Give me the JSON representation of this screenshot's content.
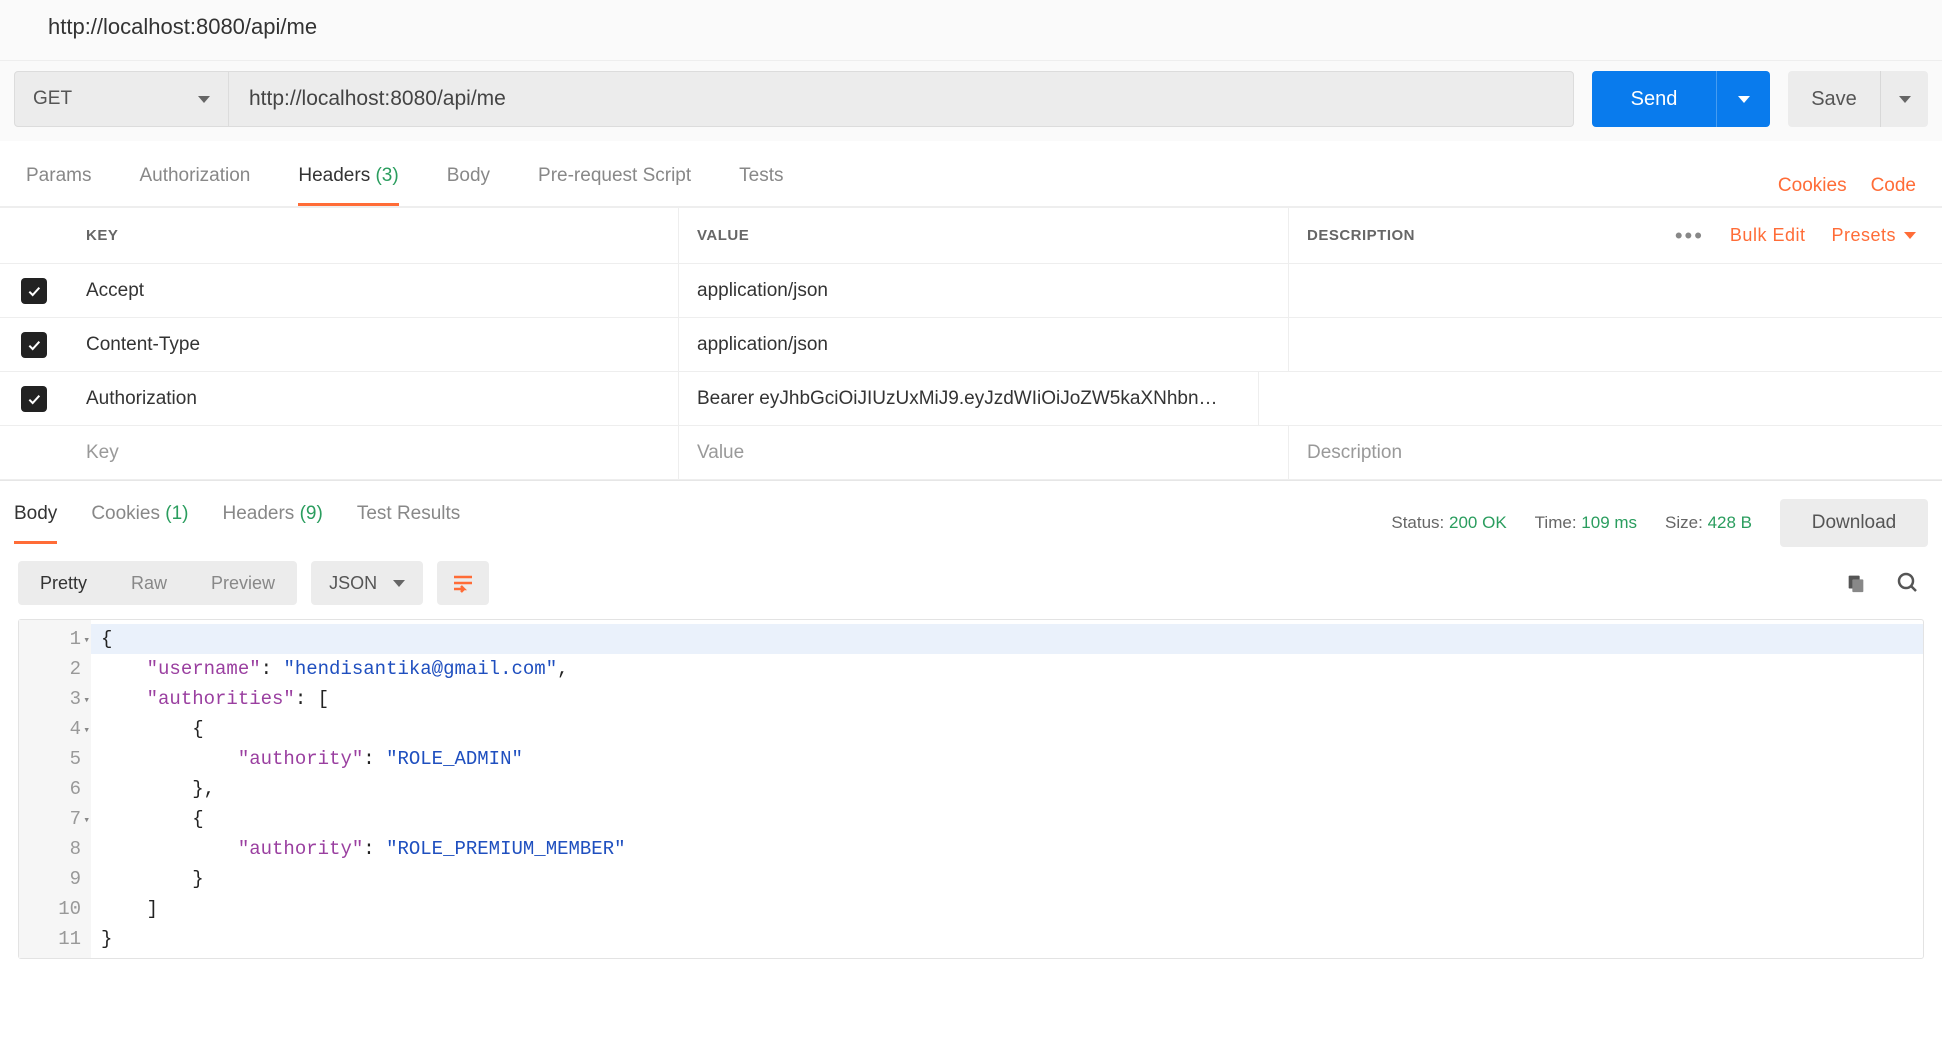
{
  "title": "http://localhost:8080/api/me",
  "request": {
    "method": "GET",
    "url": "http://localhost:8080/api/me",
    "send_label": "Send",
    "save_label": "Save"
  },
  "tabs": {
    "params": "Params",
    "authorization": "Authorization",
    "headers_label": "Headers",
    "headers_count": "(3)",
    "body": "Body",
    "prerequest": "Pre-request Script",
    "tests": "Tests",
    "cookies_link": "Cookies",
    "code_link": "Code"
  },
  "headers_table": {
    "col_key": "KEY",
    "col_value": "VALUE",
    "col_desc": "DESCRIPTION",
    "bulk_edit": "Bulk Edit",
    "presets": "Presets",
    "placeholder_key": "Key",
    "placeholder_value": "Value",
    "placeholder_desc": "Description",
    "rows": [
      {
        "key": "Accept",
        "value": "application/json",
        "desc": ""
      },
      {
        "key": "Content-Type",
        "value": "application/json",
        "desc": ""
      },
      {
        "key": "Authorization",
        "value": "Bearer eyJhbGciOiJIUzUxMiJ9.eyJzdWIiOiJoZW5kaXNhbn…",
        "desc": ""
      }
    ]
  },
  "response": {
    "tabs": {
      "body": "Body",
      "cookies_label": "Cookies",
      "cookies_count": "(1)",
      "headers_label": "Headers",
      "headers_count": "(9)",
      "test_results": "Test Results"
    },
    "status_label": "Status:",
    "status_value": "200 OK",
    "time_label": "Time:",
    "time_value": "109 ms",
    "size_label": "Size:",
    "size_value": "428 B",
    "download": "Download",
    "view": {
      "pretty": "Pretty",
      "raw": "Raw",
      "preview": "Preview",
      "format": "JSON"
    },
    "body_lines": {
      "l1": "{",
      "l2_k": "\"username\"",
      "l2_v": "\"hendisantika@gmail.com\"",
      "l3_k": "\"authorities\"",
      "l5_k": "\"authority\"",
      "l5_v": "\"ROLE_ADMIN\"",
      "l8_k": "\"authority\"",
      "l8_v": "\"ROLE_PREMIUM_MEMBER\""
    }
  }
}
